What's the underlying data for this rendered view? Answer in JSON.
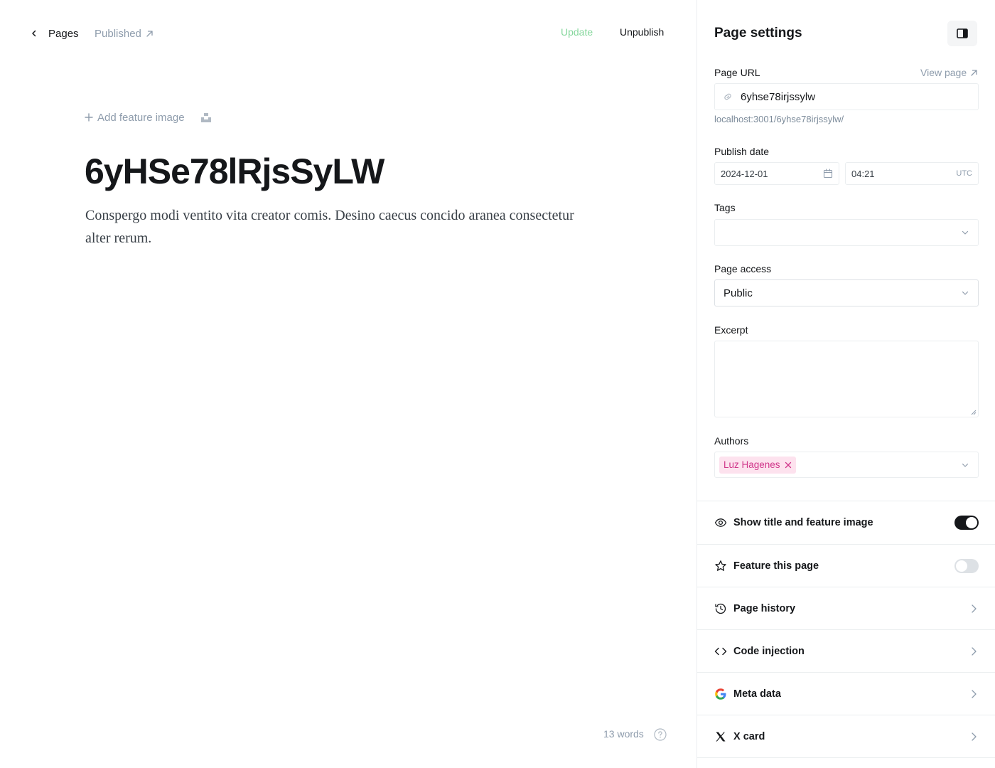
{
  "topbar": {
    "back_label": "Pages",
    "status_label": "Published",
    "update_label": "Update",
    "unpublish_label": "Unpublish"
  },
  "editor": {
    "add_feature_image_label": "Add feature image",
    "title": "6yHSe78lRjsSyLW",
    "body": "Conspergo modi ventito vita creator comis. Desino caecus concido aranea consectetur alter rerum.",
    "word_count": "13 words"
  },
  "settings": {
    "title": "Page settings",
    "url_label": "Page URL",
    "view_page_label": "View page",
    "url_value": "6yhse78irjssylw",
    "url_hint": "localhost:3001/6yhse78irjssylw/",
    "publish_date_label": "Publish date",
    "date_value": "2024-12-01",
    "time_value": "04:21",
    "timezone": "UTC",
    "tags_label": "Tags",
    "access_label": "Page access",
    "access_value": "Public",
    "excerpt_label": "Excerpt",
    "excerpt_value": "",
    "authors_label": "Authors",
    "authors": [
      "Luz Hagenes"
    ]
  },
  "options": {
    "show_title": {
      "label": "Show title and feature image",
      "enabled": true
    },
    "feature_page": {
      "label": "Feature this page",
      "enabled": false
    },
    "page_history": "Page history",
    "code_injection": "Code injection",
    "meta_data": "Meta data",
    "x_card": "X card"
  },
  "colors": {
    "accent_green": "#86d79d",
    "author_chip_bg": "#fde2ee",
    "author_chip_text": "#d0368a",
    "muted": "#8e9cac"
  }
}
